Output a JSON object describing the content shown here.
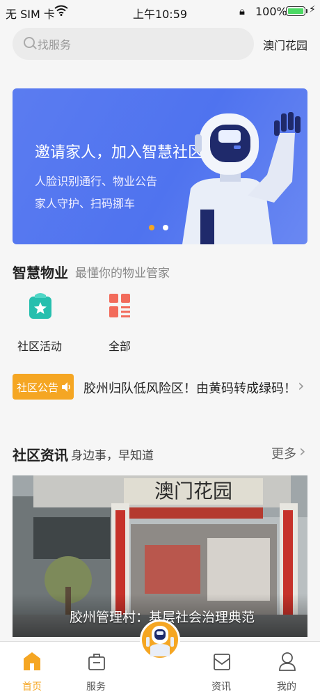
{
  "status_bar": {
    "carrier": "无 SIM 卡",
    "time": "上午10:59",
    "battery_pct": "100%"
  },
  "search": {
    "placeholder": "找服务",
    "location": "澳门花园"
  },
  "banner": {
    "title": "邀请家人，加入智慧社区",
    "line1": "人脸识别通行、物业公告",
    "line2": "家人守护、扫码挪车"
  },
  "property": {
    "title": "智慧物业",
    "subtitle": "最懂你的物业管家",
    "items": [
      {
        "label": "社区活动"
      },
      {
        "label": "全部"
      }
    ]
  },
  "notice": {
    "badge": "社区公告",
    "text": "胶州归队低风险区！由黄码转成绿码！"
  },
  "news": {
    "title": "社区资讯",
    "subtitle": "身边事，早知道",
    "more": "更多",
    "caption": "胶州管理村：基层社会治理典范",
    "image_sign": "澳门花园"
  },
  "tabbar": {
    "tabs": [
      {
        "label": "首页",
        "active": true
      },
      {
        "label": "服务",
        "active": false
      },
      {
        "label": "资讯",
        "active": false
      },
      {
        "label": "我的",
        "active": false
      }
    ]
  },
  "colors": {
    "accent": "#f5a623",
    "banner_blue": "#5b7cf0",
    "teal": "#26bfae",
    "red": "#f26b5b"
  }
}
